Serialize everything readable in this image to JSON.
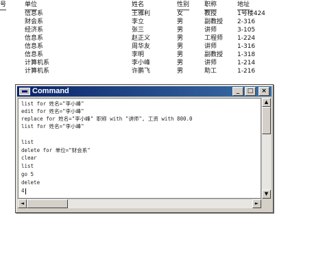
{
  "table": {
    "headers": [
      "号",
      "单位",
      "姓名",
      "性别",
      "职称",
      "地址"
    ],
    "rows": [
      [
        "",
        "信息系",
        "王雅利",
        "女",
        "教授",
        "1号楼424"
      ],
      [
        "",
        "财会系",
        "李立",
        "男",
        "副教授",
        "2-316"
      ],
      [
        "",
        "经济系",
        "张三",
        "男",
        "讲师",
        "3-105"
      ],
      [
        "",
        "信息系",
        "赵正义",
        "男",
        "工程师",
        "1-224"
      ],
      [
        "",
        "信息系",
        "周华友",
        "男",
        "讲师",
        "1-316"
      ],
      [
        "",
        "信息系",
        "李明",
        "男",
        "副教授",
        "1-318"
      ],
      [
        "",
        "计算机系",
        "李小峰",
        "男",
        "讲师",
        "1-214"
      ],
      [
        "",
        "计算机系",
        "许鹏飞",
        "男",
        "助工",
        "1-216"
      ]
    ]
  },
  "window": {
    "title": "Command",
    "minimize": "_",
    "maximize": "□",
    "close": "×",
    "lines": [
      "list for 姓名=\"李小峰\"",
      "edit for 姓名=\"李小峰\"",
      "replace for 姓名=\"李小峰\" 职称 with \"讲师\", 工资 with 800.0",
      "list for 姓名=\"李小峰\"",
      "",
      "list",
      "delete for 单位=\"财会系\"",
      "clear",
      "list",
      "go 5",
      "delete",
      "4"
    ]
  },
  "icons": {
    "window": "foxpro-command-icon",
    "scroll_up": "▲",
    "scroll_down": "▼",
    "scroll_left": "◄",
    "scroll_right": "►"
  }
}
